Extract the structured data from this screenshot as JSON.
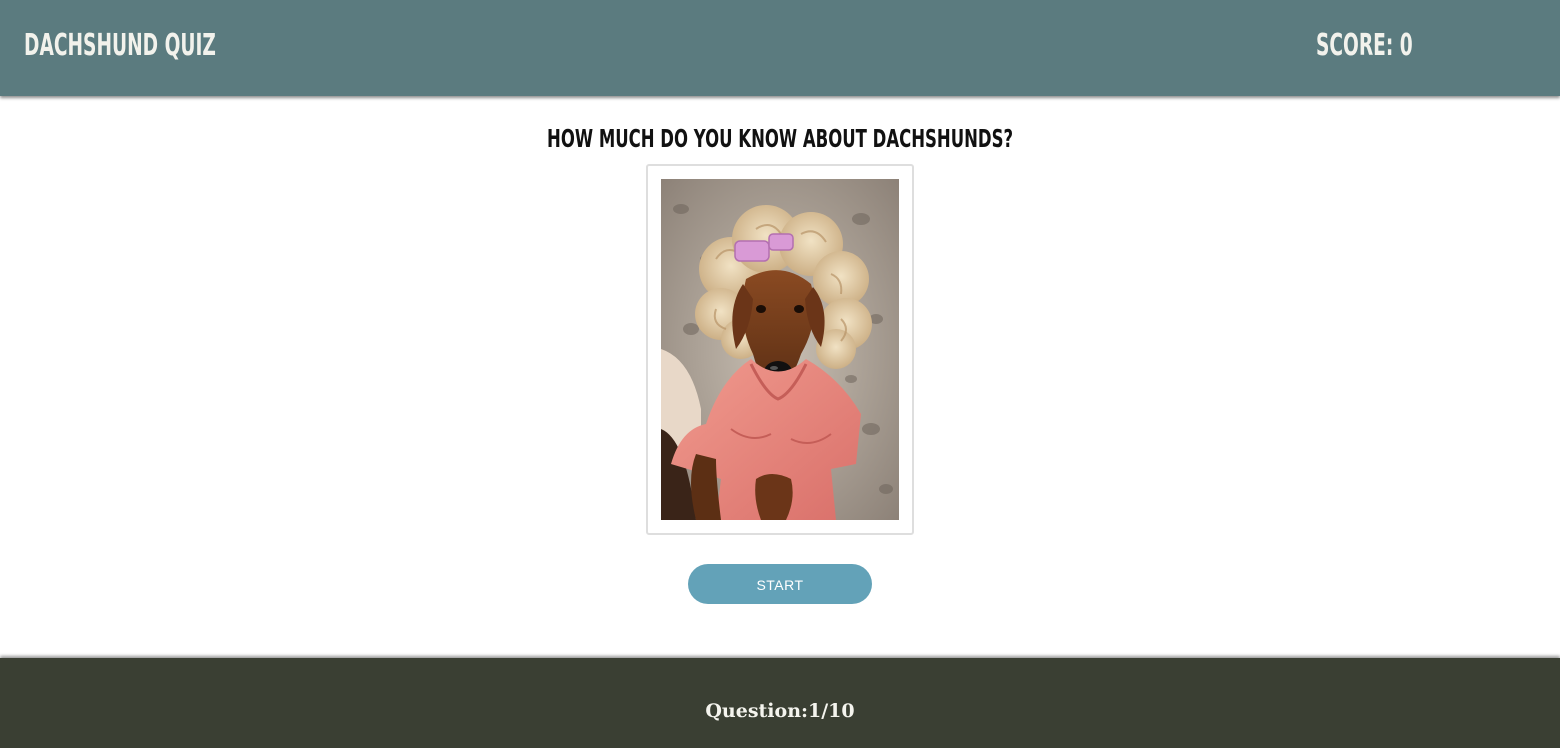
{
  "header": {
    "brand": "DACHSHUND QUIZ",
    "score_text": "SCORE: 0"
  },
  "main": {
    "headline": "HOW MUCH DO YOU KNOW ABOUT DACHSHUNDS?",
    "start_label": "START"
  },
  "footer": {
    "question_text": "Question:1/10"
  },
  "colors": {
    "header_bg": "#5b7b7f",
    "footer_bg": "#3a3f33",
    "button_bg": "#63a2b8",
    "header_text": "#f2f2ec"
  }
}
